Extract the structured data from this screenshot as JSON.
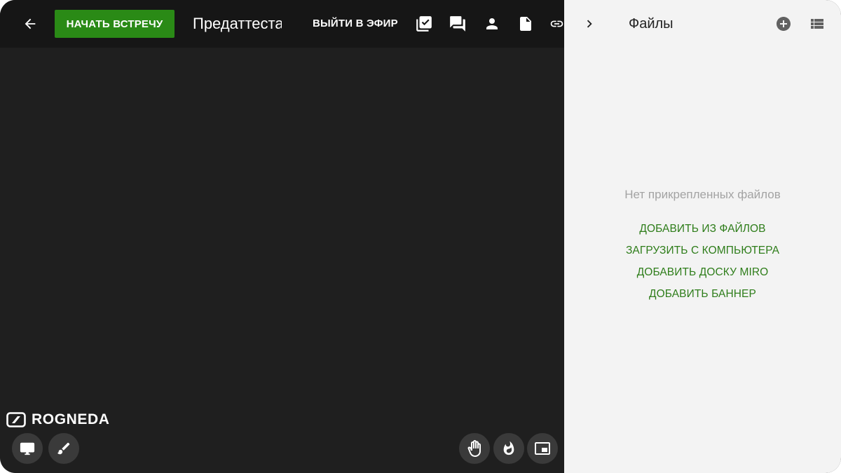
{
  "topbar": {
    "start_label": "НАЧАТЬ ВСТРЕЧУ",
    "meeting_title": "Предаттестационный",
    "go_live_label": "ВЫЙТИ В ЭФИР",
    "icons": [
      "arrow-left-icon",
      "checklist-icon",
      "chat-icon",
      "person-icon",
      "document-icon",
      "link-icon"
    ]
  },
  "logo": {
    "text": "ROGNEDA"
  },
  "bottom_left": [
    "monitor-icon",
    "brush-icon"
  ],
  "bottom_right": [
    "hand-icon",
    "fire-icon",
    "picture-in-picture-icon"
  ],
  "panel": {
    "title": "Файлы",
    "empty_message": "Нет прикрепленных файлов",
    "actions": [
      {
        "label": "ДОБАВИТЬ ИЗ ФАЙЛОВ"
      },
      {
        "label": "ЗАГРУЗИТЬ С КОМПЬЮТЕРА"
      },
      {
        "label": "ДОБАВИТЬ ДОСКУ MIRO"
      },
      {
        "label": "ДОБАВИТЬ БАННЕР"
      }
    ]
  },
  "colors": {
    "accent_green": "#2a8a16",
    "link_green": "#2e7d1a",
    "stage_bg": "#1f1f1f",
    "panel_bg": "#f3f3f3"
  }
}
